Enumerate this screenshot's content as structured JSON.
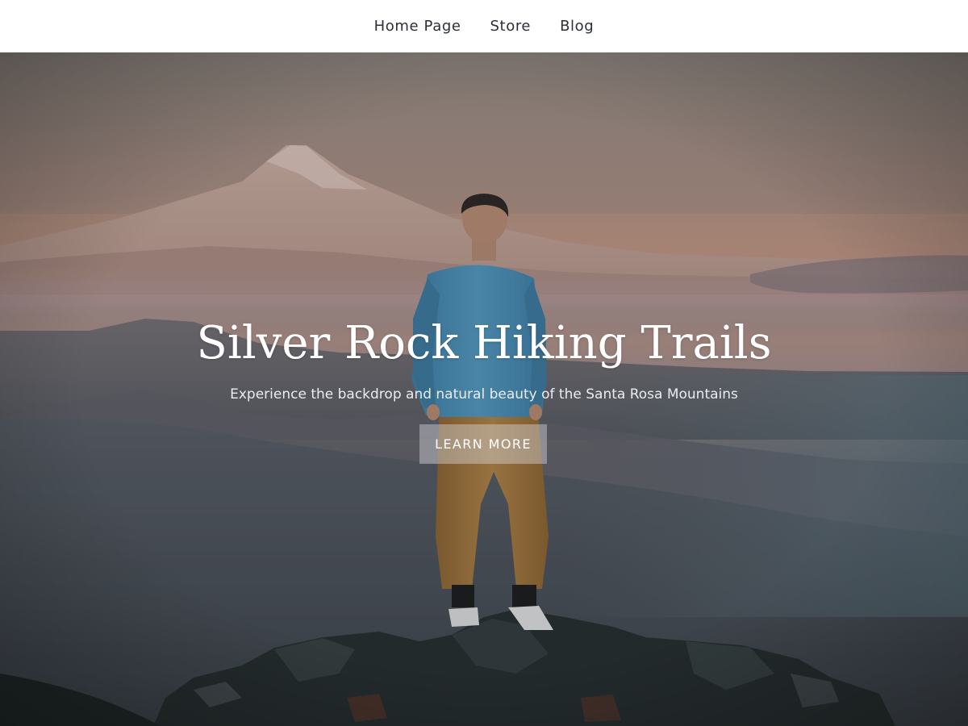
{
  "nav": {
    "items": [
      {
        "label": "Home Page"
      },
      {
        "label": "Store"
      },
      {
        "label": "Blog"
      }
    ]
  },
  "hero": {
    "title": "Silver Rock Hiking Trails",
    "subtitle": "Experience the backdrop and natural beauty of the Santa Rosa Mountains",
    "button_label": "LEARN MORE"
  },
  "colors": {
    "nav_text": "#2b2f36",
    "sky_top": "#9a8c86",
    "haze_warm": "#c79a86",
    "valley": "#5e6771",
    "rock": "#2d3435",
    "shirt": "#4d8db2",
    "pants": "#a77d44"
  }
}
